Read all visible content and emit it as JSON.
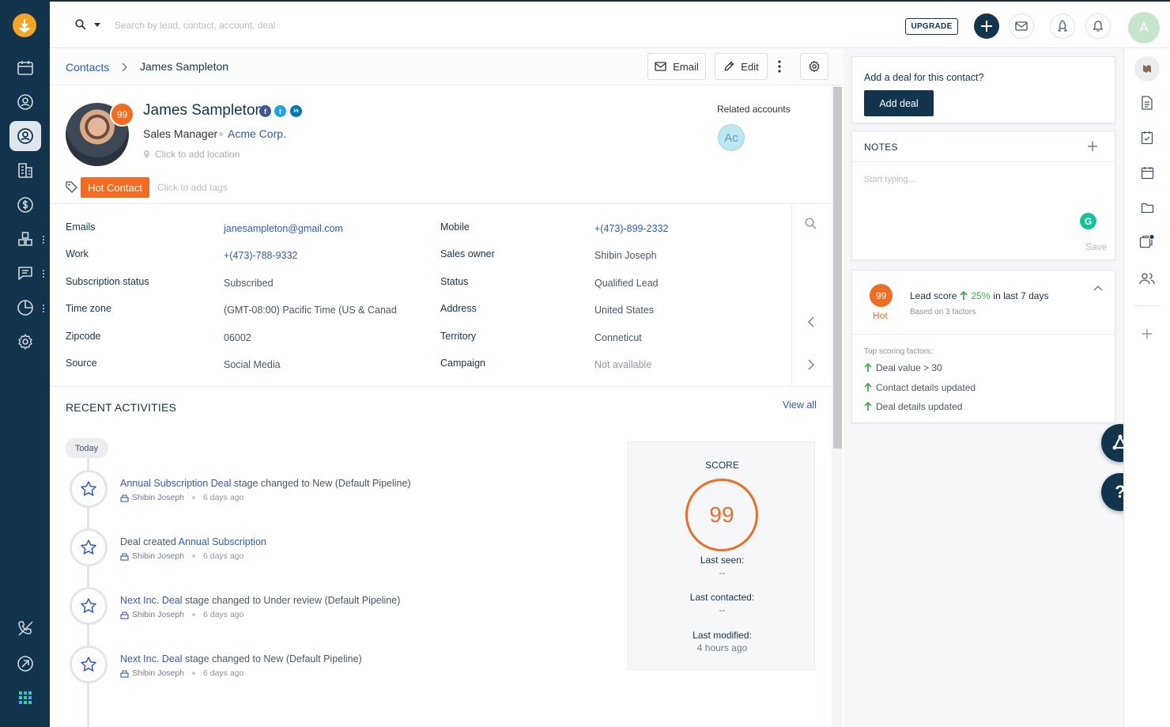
{
  "app": {
    "accent": "#12344d",
    "brand": "#f36c21",
    "link": "#2c5cc5"
  },
  "topbar": {
    "search_placeholder": "Search by lead, contact, account, deal",
    "upgrade_label": "UPGRADE",
    "avatar_initial": "A"
  },
  "breadcrumb": {
    "parent": "Contacts",
    "current": "James Sampleton"
  },
  "actions": {
    "email_label": "Email",
    "edit_label": "Edit"
  },
  "profile": {
    "name": "James Sampleton",
    "score": "99",
    "title": "Sales Manager",
    "company": "Acme Corp.",
    "location_placeholder": "Click to add location",
    "tag": "Hot Contact",
    "tags_placeholder": "Click to add tags",
    "social": {
      "facebook": "f",
      "twitter": "t",
      "linkedin": "in"
    }
  },
  "related": {
    "label": "Related accounts",
    "avatar": "Ac"
  },
  "fields": {
    "left": [
      {
        "label": "Emails",
        "value": "janesampleton@gmail.com"
      },
      {
        "label": "Work",
        "value": "+(473)-788-9332"
      },
      {
        "label": "Subscription status",
        "value": "Subscribed"
      },
      {
        "label": "Time zone",
        "value": "(GMT-08:00) Pacific Time (US & Canad"
      },
      {
        "label": "Zipcode",
        "value": "06002"
      },
      {
        "label": "Source",
        "value": "Social Media"
      }
    ],
    "right": [
      {
        "label": "Mobile",
        "value": "+(473)-899-2332"
      },
      {
        "label": "Sales owner",
        "value": "Shibin Joseph"
      },
      {
        "label": "Status",
        "value": "Qualified Lead"
      },
      {
        "label": "Address",
        "value": "United States"
      },
      {
        "label": "Territory",
        "value": "Conneticut"
      },
      {
        "label": "Campaign",
        "value": "Not available"
      }
    ]
  },
  "activities": {
    "title": "RECENT ACTIVITIES",
    "view_all": "View all",
    "today": "Today",
    "items": [
      {
        "pre": "",
        "link": "Annual Subscription Deal",
        "post": " stage changed to New (Default Pipeline)",
        "user": "Shibin Joseph",
        "time": "6 days ago"
      },
      {
        "pre": "Deal created ",
        "link": "Annual Subscription",
        "post": "",
        "user": "Shibin Joseph",
        "time": "6 days ago"
      },
      {
        "pre": "",
        "link": "Next Inc. Deal",
        "post": " stage changed to Under review (Default Pipeline)",
        "user": "Shibin Joseph",
        "time": "6 days ago"
      },
      {
        "pre": "",
        "link": "Next Inc. Deal",
        "post": " stage changed to New (Default Pipeline)",
        "user": "Shibin Joseph",
        "time": "6 days ago"
      }
    ]
  },
  "score_card": {
    "title": "SCORE",
    "value": "99",
    "last_seen_label": "Last seen:",
    "last_seen": "--",
    "last_contacted_label": "Last contacted:",
    "last_contacted": "--",
    "last_modified_label": "Last modified:",
    "last_modified": "4 hours ago"
  },
  "deal_card": {
    "title": "Add a deal for this contact?",
    "button": "Add deal"
  },
  "notes": {
    "title": "NOTES",
    "placeholder": "Start typing...",
    "save": "Save",
    "grammarly": "G"
  },
  "lead_score": {
    "value": "99",
    "grade": "Hot",
    "label": "Lead score",
    "change": "25%",
    "period": "in last 7 days",
    "sub": "Based on 3 factors",
    "factors_title": "Top scoring factors:",
    "factors": [
      "Deal value > 30",
      "Contact details updated",
      "Deal details updated"
    ]
  },
  "help": {
    "label": "?"
  }
}
